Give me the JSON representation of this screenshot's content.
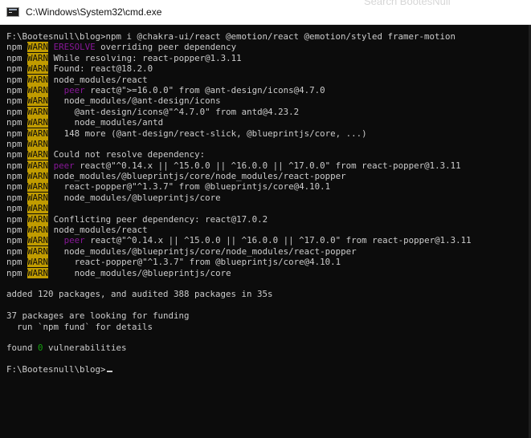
{
  "window": {
    "title": "C:\\Windows\\System32\\cmd.exe",
    "icon": "cmd-icon"
  },
  "background_search": {
    "placeholder": "Search BootesNull"
  },
  "colors": {
    "terminal_bg": "#0c0c0c",
    "text": "#cccccc",
    "warn_bg": "#c19c00",
    "warn_fg": "#0c0c0c",
    "eresolve": "#881798",
    "peer": "#881798",
    "zero": "#13a10e"
  },
  "terminal": {
    "lines": [
      {
        "type": "plain",
        "text": "F:\\Bootesnull\\blog>npm i @chakra-ui/react @emotion/react @emotion/styled framer-motion"
      },
      {
        "type": "warn",
        "prefix": "npm",
        "badge": "WARN",
        "pre": "",
        "highlight": "ERESOLVE",
        "post": " overriding peer dependency"
      },
      {
        "type": "warn",
        "prefix": "npm",
        "badge": "WARN",
        "pre": "While resolving: react-popper@1.3.11",
        "highlight": "",
        "post": ""
      },
      {
        "type": "warn",
        "prefix": "npm",
        "badge": "WARN",
        "pre": "Found: react@18.2.0",
        "highlight": "",
        "post": ""
      },
      {
        "type": "warn",
        "prefix": "npm",
        "badge": "WARN",
        "pre": "node_modules/react",
        "highlight": "",
        "post": ""
      },
      {
        "type": "warn",
        "prefix": "npm",
        "badge": "WARN",
        "pre": "  ",
        "highlight": "peer",
        "post": " react@\">=16.0.0\" from @ant-design/icons@4.7.0"
      },
      {
        "type": "warn",
        "prefix": "npm",
        "badge": "WARN",
        "pre": "  node_modules/@ant-design/icons",
        "highlight": "",
        "post": ""
      },
      {
        "type": "warn",
        "prefix": "npm",
        "badge": "WARN",
        "pre": "    @ant-design/icons@\"^4.7.0\" from antd@4.23.2",
        "highlight": "",
        "post": ""
      },
      {
        "type": "warn",
        "prefix": "npm",
        "badge": "WARN",
        "pre": "    node_modules/antd",
        "highlight": "",
        "post": ""
      },
      {
        "type": "warn",
        "prefix": "npm",
        "badge": "WARN",
        "pre": "  148 more (@ant-design/react-slick, @blueprintjs/core, ...)",
        "highlight": "",
        "post": ""
      },
      {
        "type": "warn",
        "prefix": "npm",
        "badge": "WARN",
        "pre": "",
        "highlight": "",
        "post": ""
      },
      {
        "type": "warn",
        "prefix": "npm",
        "badge": "WARN",
        "pre": "Could not resolve dependency:",
        "highlight": "",
        "post": ""
      },
      {
        "type": "warn",
        "prefix": "npm",
        "badge": "WARN",
        "pre": "",
        "highlight": "peer",
        "post": " react@\"^0.14.x || ^15.0.0 || ^16.0.0 || ^17.0.0\" from react-popper@1.3.11"
      },
      {
        "type": "warn",
        "prefix": "npm",
        "badge": "WARN",
        "pre": "node_modules/@blueprintjs/core/node_modules/react-popper",
        "highlight": "",
        "post": ""
      },
      {
        "type": "warn",
        "prefix": "npm",
        "badge": "WARN",
        "pre": "  react-popper@\"^1.3.7\" from @blueprintjs/core@4.10.1",
        "highlight": "",
        "post": ""
      },
      {
        "type": "warn",
        "prefix": "npm",
        "badge": "WARN",
        "pre": "  node_modules/@blueprintjs/core",
        "highlight": "",
        "post": ""
      },
      {
        "type": "warn",
        "prefix": "npm",
        "badge": "WARN",
        "pre": "",
        "highlight": "",
        "post": ""
      },
      {
        "type": "warn",
        "prefix": "npm",
        "badge": "WARN",
        "pre": "Conflicting peer dependency: react@17.0.2",
        "highlight": "",
        "post": ""
      },
      {
        "type": "warn",
        "prefix": "npm",
        "badge": "WARN",
        "pre": "node_modules/react",
        "highlight": "",
        "post": ""
      },
      {
        "type": "warn",
        "prefix": "npm",
        "badge": "WARN",
        "pre": "  ",
        "highlight": "peer",
        "post": " react@\"^0.14.x || ^15.0.0 || ^16.0.0 || ^17.0.0\" from react-popper@1.3.11"
      },
      {
        "type": "warn",
        "prefix": "npm",
        "badge": "WARN",
        "pre": "  node_modules/@blueprintjs/core/node_modules/react-popper",
        "highlight": "",
        "post": ""
      },
      {
        "type": "warn",
        "prefix": "npm",
        "badge": "WARN",
        "pre": "    react-popper@\"^1.3.7\" from @blueprintjs/core@4.10.1",
        "highlight": "",
        "post": ""
      },
      {
        "type": "warn",
        "prefix": "npm",
        "badge": "WARN",
        "pre": "    node_modules/@blueprintjs/core",
        "highlight": "",
        "post": ""
      },
      {
        "type": "blank"
      },
      {
        "type": "plain",
        "text": "added 120 packages, and audited 388 packages in 35s"
      },
      {
        "type": "blank"
      },
      {
        "type": "plain",
        "text": "37 packages are looking for funding"
      },
      {
        "type": "plain",
        "text": "  run `npm fund` for details"
      },
      {
        "type": "blank"
      },
      {
        "type": "found",
        "pre": "found ",
        "zero": "0",
        "post": " vulnerabilities"
      },
      {
        "type": "blank"
      },
      {
        "type": "prompt",
        "text": "F:\\Bootesnull\\blog>"
      }
    ]
  }
}
